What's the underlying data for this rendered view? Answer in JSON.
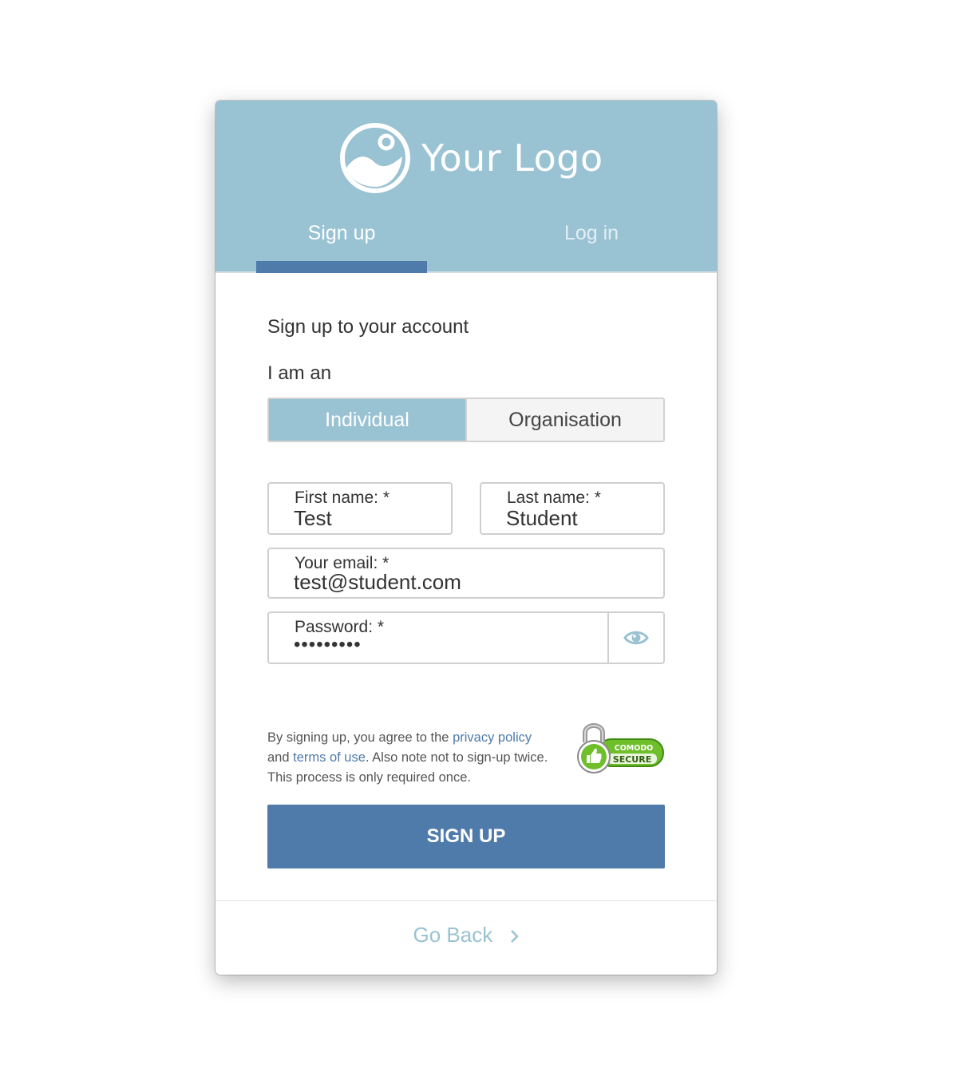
{
  "logo": {
    "text": "Your Logo",
    "icon": "image-icon"
  },
  "tabs": {
    "signup": "Sign up",
    "login": "Log in",
    "active": "signup"
  },
  "form": {
    "heading": "Sign up to your account",
    "account_type_label": "I am an",
    "account_types": [
      "Individual",
      "Organisation"
    ],
    "selected_account_type": "Individual",
    "first_name": {
      "label": "First name: *",
      "value": "Test"
    },
    "last_name": {
      "label": "Last name: *",
      "value": "Student"
    },
    "email": {
      "label": "Your email: *",
      "value": "test@student.com"
    },
    "password": {
      "label": "Password: *",
      "value": "•••••••••",
      "toggle_icon": "eye-icon"
    }
  },
  "terms": {
    "prefix": "By signing up, you agree to the ",
    "privacy_link": "privacy policy",
    "middle_a": "and ",
    "terms_link": "terms of use",
    "suffix": ". Also note not to sign-up twice. This process is only required once."
  },
  "badge": {
    "line1": "COMODO",
    "line2": "SECURE"
  },
  "submit_label": "SIGN UP",
  "footer": {
    "go_back": "Go Back",
    "icon": "chevron-right-icon"
  },
  "colors": {
    "header": "#99c2d3",
    "accent": "#4f7bab",
    "badge_green": "#6fbf2a"
  }
}
